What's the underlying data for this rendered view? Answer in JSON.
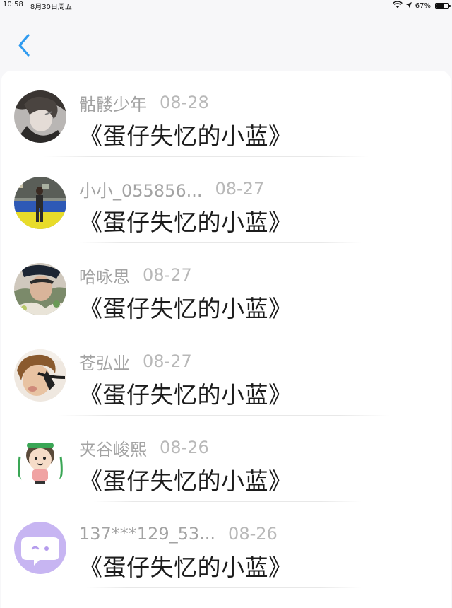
{
  "status_bar": {
    "time": "10:58",
    "date": "8月30日周五",
    "battery_percent": "67%",
    "battery_level": 0.67,
    "wifi_icon": "wifi-icon",
    "battery_icon": "battery-icon"
  },
  "nav": {
    "back_icon": "chevron-left-icon",
    "accent_color": "#2f9bf0"
  },
  "items": [
    {
      "username": "骷髅少年",
      "date": "08-28",
      "message": "《蛋仔失忆的小蓝》"
    },
    {
      "username": "小小_055856...",
      "date": "08-27",
      "message": "《蛋仔失忆的小蓝》"
    },
    {
      "username": "哈咏思",
      "date": "08-27",
      "message": "《蛋仔失忆的小蓝》"
    },
    {
      "username": "苍弘业",
      "date": "08-27",
      "message": "《蛋仔失忆的小蓝》"
    },
    {
      "username": "夹谷峻熙",
      "date": "08-26",
      "message": "《蛋仔失忆的小蓝》"
    },
    {
      "username": "137***129_53...",
      "date": "08-26",
      "message": "《蛋仔失忆的小蓝》"
    }
  ]
}
